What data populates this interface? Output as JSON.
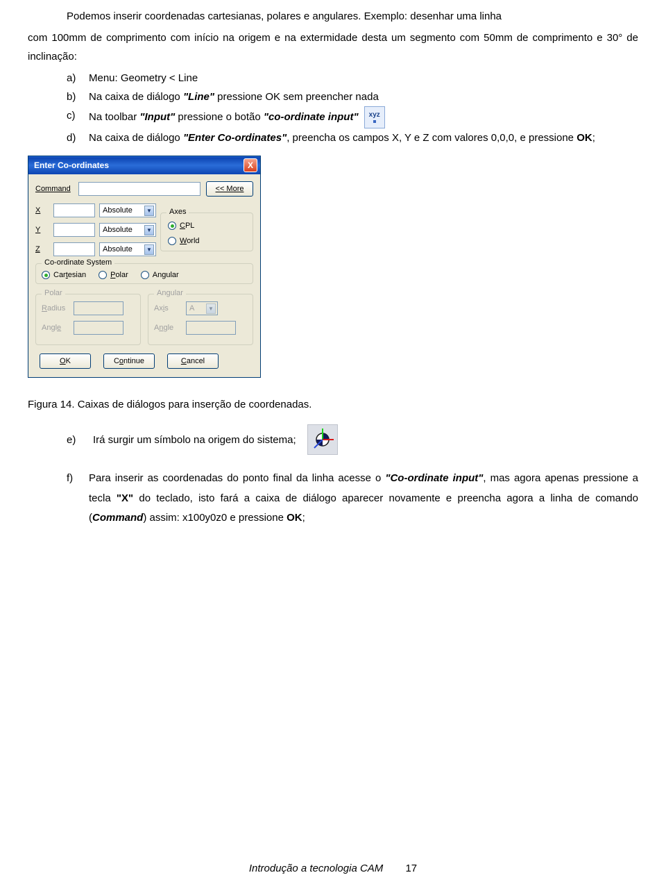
{
  "para1_a": "Podemos inserir coordenadas cartesianas, polares e angulares. Exemplo: desenhar uma linha",
  "para1_b": "com 100mm de comprimento com início na origem e na extermidade desta um segmento com 50mm de comprimento e 30° de inclinação:",
  "list": {
    "a": {
      "lbl": "a)",
      "txt": "Menu: Geometry < Line"
    },
    "b": {
      "lbl": "b)",
      "txt_pre": "Na caixa de diálogo ",
      "txt_q1": "\"Line\"",
      "txt_post": " pressione OK sem preencher nada"
    },
    "c": {
      "lbl": "c)",
      "txt_pre": "Na toolbar ",
      "txt_q1": "\"Input\"",
      "txt_mid": " pressione o botão ",
      "txt_q2": "\"co-ordinate input\""
    },
    "d": {
      "lbl": "d)",
      "txt_pre": "Na caixa de diálogo ",
      "txt_q1": "\"Enter Co-ordinates\"",
      "txt_mid": ", preencha os campos X, Y e Z com valores 0,0,0, e pressione ",
      "txt_bold": "OK",
      "txt_post": ";"
    }
  },
  "icon_xyz_text": "xyz",
  "dialog": {
    "title": "Enter Co-ordinates",
    "close": "X",
    "command_label": "Command",
    "more_btn": "<< More",
    "axis": {
      "x": "X",
      "y": "Y",
      "z": "Z"
    },
    "abs": "Absolute",
    "axes_legend": "Axes",
    "axes_cpl": "CPL",
    "axes_world": "World",
    "coord_legend": "Co-ordinate System",
    "coord_cart": "Cartesian",
    "coord_polar": "Polar",
    "coord_ang": "Angular",
    "polar_legend": "Polar",
    "polar_radius": "Radius",
    "polar_angle": "Angle",
    "angular_legend": "Angular",
    "angular_axis": "Axis",
    "angular_a": "A",
    "angular_angle": "Angle",
    "ok": "OK",
    "continue": "Continue",
    "cancel": "Cancel"
  },
  "figcap": "Figura 14. Caixas de diálogos para inserção de coordenadas.",
  "list2": {
    "e": {
      "lbl": "e)",
      "txt": "Irá surgir um símbolo na origem do sistema;"
    },
    "f": {
      "lbl": "f)",
      "p1": "Para inserir as coordenadas do ponto final da linha acesse o ",
      "q1": "\"Co-ordinate input\"",
      "p2": ", mas agora apenas pressione a tecla ",
      "b1": "\"X\"",
      "p3": " do teclado, isto fará a caixa de diálogo aparecer novamente e preencha agora a linha de comando (",
      "b2": "Command",
      "p4": ") assim: x100y0z0 e pressione ",
      "b3": "OK",
      "p5": ";"
    }
  },
  "footer_text": "Introdução a tecnologia CAM",
  "page_number": "17"
}
